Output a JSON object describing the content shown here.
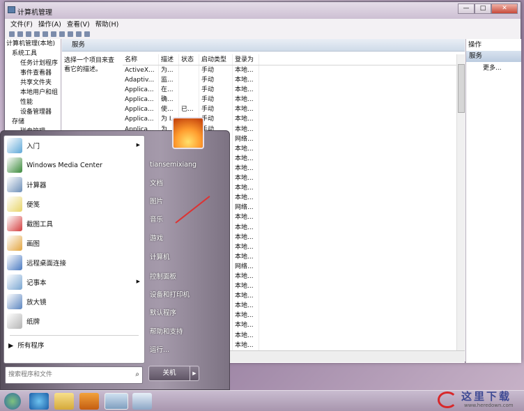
{
  "window": {
    "title": "计算机管理",
    "buttons": [
      "—",
      "□",
      "✕"
    ]
  },
  "menu": [
    "文件(F)",
    "操作(A)",
    "查看(V)",
    "帮助(H)"
  ],
  "tree": [
    "计算机管理(本地)",
    "系统工具",
    "任务计划程序",
    "事件查看器",
    "共享文件夹",
    "本地用户和组",
    "性能",
    "设备管理器",
    "存储",
    "磁盘管理"
  ],
  "services_header": "服务",
  "description": "选择一个项目来查看它的描述。",
  "table": {
    "headers": [
      "名称",
      "描述",
      "状态",
      "启动类型",
      "登录为"
    ],
    "rows": [
      [
        "ActiveX...",
        "为...",
        "",
        "手动",
        "本地..."
      ],
      [
        "Adaptiv...",
        "监...",
        "",
        "手动",
        "本地..."
      ],
      [
        "Applica...",
        "在...",
        "",
        "手动",
        "本地..."
      ],
      [
        "Applica...",
        "确...",
        "",
        "手动",
        "本地..."
      ],
      [
        "Applica...",
        "使...",
        "已...",
        "手动",
        "本地..."
      ],
      [
        "Applica...",
        "为 I...",
        "",
        "手动",
        "本地..."
      ],
      [
        "Applica...",
        "为...",
        "",
        "手动",
        "本地..."
      ],
      [
        "",
        "",
        "",
        "",
        "网络..."
      ],
      [
        "",
        "",
        "",
        "",
        "本地..."
      ],
      [
        "",
        "",
        "",
        "",
        "本地..."
      ],
      [
        "",
        "",
        "",
        "",
        "本地..."
      ],
      [
        "",
        "",
        "",
        "",
        "本地..."
      ],
      [
        "",
        "",
        "",
        "",
        "本地..."
      ],
      [
        "",
        "",
        "",
        "",
        "本地..."
      ],
      [
        "",
        "",
        "",
        "",
        "网络..."
      ],
      [
        "",
        "",
        "",
        "",
        "本地..."
      ],
      [
        "",
        "",
        "",
        "",
        "本地..."
      ],
      [
        "",
        "",
        "",
        "",
        "本地..."
      ],
      [
        "",
        "",
        "",
        "",
        "本地..."
      ],
      [
        "",
        "",
        "",
        "",
        "本地..."
      ],
      [
        "",
        "",
        "",
        "",
        "网络..."
      ],
      [
        "",
        "",
        "",
        "",
        "本地..."
      ],
      [
        "",
        "",
        "",
        "",
        "本地..."
      ],
      [
        "",
        "",
        "",
        "",
        "本地..."
      ],
      [
        "",
        "",
        "",
        "",
        "本地..."
      ],
      [
        "",
        "",
        "",
        "",
        "本地..."
      ],
      [
        "",
        "",
        "",
        "",
        "本地..."
      ],
      [
        "",
        "",
        "",
        "",
        "本地..."
      ],
      [
        "",
        "",
        "",
        "",
        "本地..."
      ]
    ]
  },
  "actions": {
    "header": "操作",
    "sub": "服务",
    "more": "更多..."
  },
  "startmenu": {
    "programs": [
      {
        "label": "入门",
        "color": "#5fa8d8",
        "arrow": true
      },
      {
        "label": "Windows Media Center",
        "color": "#3b8a3b",
        "arrow": false
      },
      {
        "label": "计算器",
        "color": "#6d8fb8",
        "arrow": false
      },
      {
        "label": "便笺",
        "color": "#e8d468",
        "arrow": false
      },
      {
        "label": "截图工具",
        "color": "#d44040",
        "arrow": false
      },
      {
        "label": "画图",
        "color": "#e3a640",
        "arrow": false
      },
      {
        "label": "远程桌面连接",
        "color": "#4b7bc2",
        "arrow": false
      },
      {
        "label": "记事本",
        "color": "#79a6d2",
        "arrow": true
      },
      {
        "label": "放大镜",
        "color": "#5c86c0",
        "arrow": false
      },
      {
        "label": "纸牌",
        "color": "#b5b5b5",
        "arrow": false
      }
    ],
    "all_programs": "所有程序",
    "search_placeholder": "搜索程序和文件",
    "right": [
      "tiansemixiang",
      "文档",
      "图片",
      "音乐",
      "游戏",
      "计算机",
      "控制面板",
      "设备和打印机",
      "默认程序",
      "帮助和支持",
      "运行..."
    ],
    "shutdown": "关机"
  },
  "watermark": {
    "big": "这里下载",
    "small": "www.heredown.com"
  }
}
